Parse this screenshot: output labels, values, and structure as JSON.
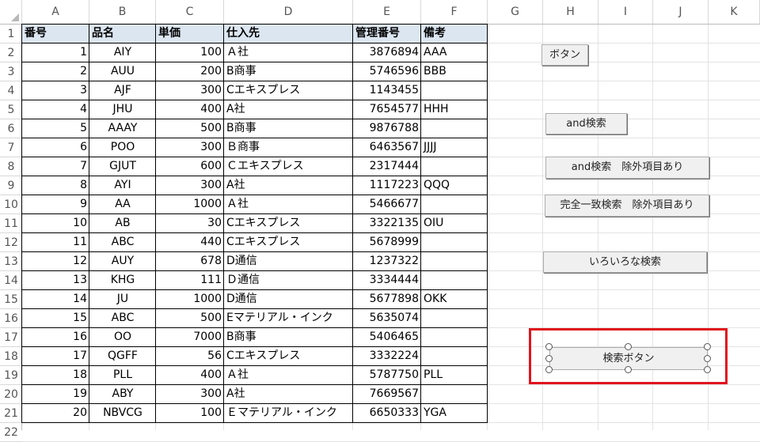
{
  "columns": [
    "A",
    "B",
    "C",
    "D",
    "E",
    "F",
    "G",
    "H",
    "I",
    "J",
    "K"
  ],
  "row_numbers": [
    1,
    2,
    3,
    4,
    5,
    6,
    7,
    8,
    9,
    10,
    11,
    12,
    13,
    14,
    15,
    16,
    17,
    18,
    19,
    20,
    21,
    22
  ],
  "table": {
    "headers": [
      "番号",
      "品名",
      "単価",
      "仕入先",
      "管理番号",
      "備考"
    ],
    "rows": [
      [
        "1",
        "AIY",
        "100",
        "Ａ社",
        "3876894",
        "AAA"
      ],
      [
        "2",
        "AUU",
        "200",
        "B商事",
        "5746596",
        "BBB"
      ],
      [
        "3",
        "AJF",
        "300",
        "Cエキスプレス",
        "1143455",
        ""
      ],
      [
        "4",
        "JHU",
        "400",
        "A社",
        "7654577",
        "HHH"
      ],
      [
        "5",
        "AAAY",
        "500",
        "B商事",
        "9876788",
        ""
      ],
      [
        "6",
        "POO",
        "300",
        "Ｂ商事",
        "6463567",
        "JJJJ"
      ],
      [
        "7",
        "GJUT",
        "600",
        "Ｃエキスプレス",
        "2317444",
        ""
      ],
      [
        "8",
        "AYI",
        "300",
        "A社",
        "1117223",
        "QQQ"
      ],
      [
        "9",
        "AA",
        "1000",
        "Ａ社",
        "5466677",
        ""
      ],
      [
        "10",
        "AB",
        "30",
        "Cエキスプレス",
        "3322135",
        "OIU"
      ],
      [
        "11",
        "ABC",
        "440",
        "Cエキスプレス",
        "5678999",
        ""
      ],
      [
        "12",
        "AUY",
        "678",
        "D通信",
        "1237322",
        ""
      ],
      [
        "13",
        "KHG",
        "111",
        "Ｄ通信",
        "3334444",
        ""
      ],
      [
        "14",
        "JU",
        "1000",
        "D通信",
        "5677898",
        "OKK"
      ],
      [
        "15",
        "ABC",
        "500",
        "Eマテリアル・インク",
        "5635074",
        ""
      ],
      [
        "16",
        "OO",
        "7000",
        "B商事",
        "5406465",
        ""
      ],
      [
        "17",
        "QGFF",
        "56",
        "Cエキスプレス",
        "3332224",
        ""
      ],
      [
        "18",
        "PLL",
        "400",
        "Ａ社",
        "5787750",
        "PLL"
      ],
      [
        "19",
        "ABY",
        "300",
        "A社",
        "7669567",
        ""
      ],
      [
        "20",
        "NBVCG",
        "100",
        "Ｅマテリアル・インク",
        "6650333",
        "YGA"
      ]
    ]
  },
  "buttons": {
    "button1": "ボタン",
    "and_search": "and検索",
    "and_search_exclude": "and検索　除外項目あり",
    "exact_search_exclude": "完全一致検索　除外項目あり",
    "various_search": "いろいろな検索",
    "search_button": "検索ボタン"
  },
  "colors": {
    "header_fill": "#dce6f1",
    "highlight": "#e0141e"
  }
}
